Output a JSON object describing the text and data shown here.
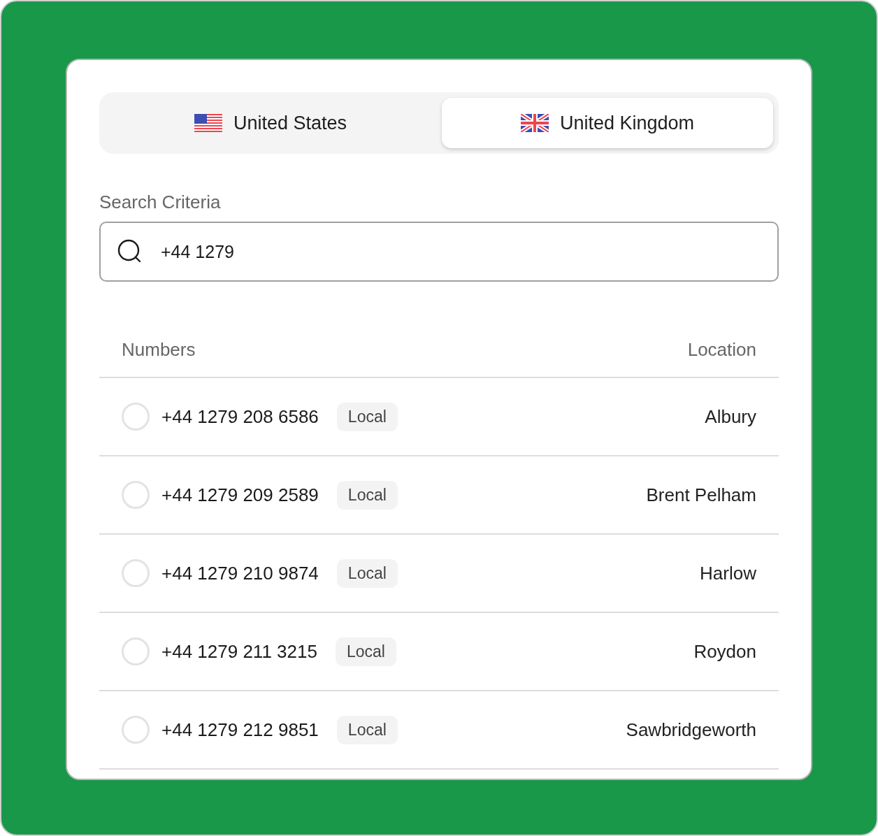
{
  "tabs": [
    {
      "label": "United States",
      "kind": "us",
      "selected": false
    },
    {
      "label": "United Kingdom",
      "kind": "uk",
      "selected": true
    }
  ],
  "search": {
    "label": "Search Criteria",
    "value": "+44 1279"
  },
  "table": {
    "columns": [
      "Numbers",
      "Location"
    ],
    "rows": [
      {
        "number": "+44 1279 208 6586",
        "badge": "Local",
        "location": "Albury",
        "selected": false
      },
      {
        "number": "+44 1279 209 2589",
        "badge": "Local",
        "location": "Brent Pelham",
        "selected": false
      },
      {
        "number": "+44 1279 210 9874",
        "badge": "Local",
        "location": "Harlow",
        "selected": false
      },
      {
        "number": "+44 1279 211 3215",
        "badge": "Local",
        "location": "Roydon",
        "selected": false
      },
      {
        "number": "+44 1279 212 9851",
        "badge": "Local",
        "location": "Sawbridgeworth",
        "selected": false
      }
    ]
  }
}
